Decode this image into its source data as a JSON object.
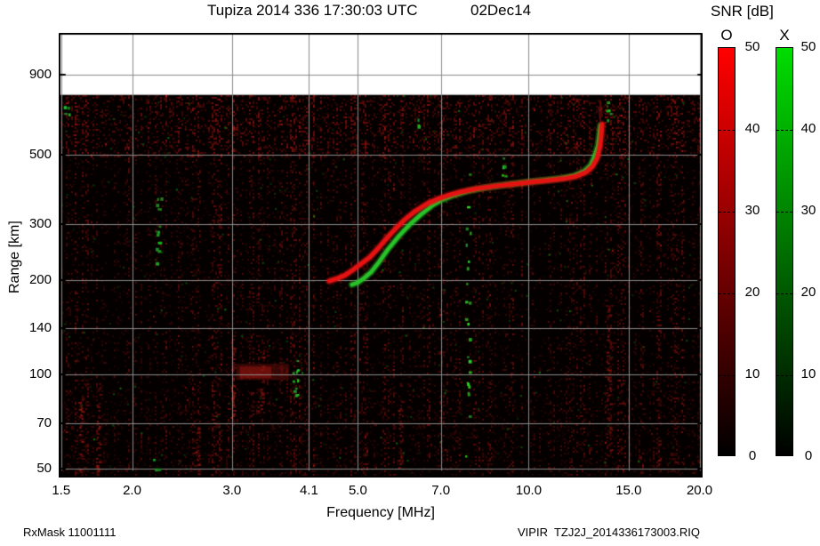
{
  "header": {
    "title": "Tupiza 2014 336 17:30:03 UTC",
    "date": "02Dec14"
  },
  "footer": {
    "rx_mask": "RxMask 11001111",
    "data_file": "VIPIR  TZJ2J_2014336173003.RIQ"
  },
  "chart_data": {
    "type": "heatmap",
    "title": "Tupiza 2014 336 17:30:03 UTC",
    "subtitle": "02Dec14",
    "x_axis": {
      "label": "Frequency [MHz]",
      "scale": "log",
      "lim": [
        1.485,
        20.25
      ],
      "tick_values": [
        1.5,
        2,
        3,
        4.1,
        5,
        7,
        10,
        15,
        20
      ],
      "tick_labels": [
        "1.5",
        "2.0",
        "3.0",
        "4.1",
        "5.0",
        "7.0",
        "10.0",
        "15.0",
        "20.0"
      ],
      "grid": true
    },
    "y_axis": {
      "label": "Range [km]",
      "scale": "log",
      "lim": [
        47,
        1220
      ],
      "tick_values": [
        50,
        70,
        100,
        140,
        200,
        300,
        500,
        900
      ],
      "tick_labels": [
        "50",
        "70",
        "100",
        "140",
        "200",
        "300",
        "500",
        "900"
      ],
      "grid": true
    },
    "data_region_top_km": 775,
    "colorbar": {
      "title": "SNR [dB]",
      "min": 0,
      "max": 50,
      "tick_values": [
        50,
        40,
        30,
        20,
        10,
        0
      ],
      "bars": [
        {
          "mode": "O",
          "top_color": "#ff0000"
        },
        {
          "mode": "X",
          "top_color": "#00dd00"
        }
      ]
    },
    "traces": [
      {
        "name": "O-mode echo",
        "color": "#e51212",
        "points": [
          [
            4.45,
            198
          ],
          [
            4.6,
            202
          ],
          [
            4.75,
            207
          ],
          [
            4.9,
            215
          ],
          [
            5.05,
            224
          ],
          [
            5.25,
            236
          ],
          [
            5.45,
            254
          ],
          [
            5.65,
            274
          ],
          [
            5.85,
            293
          ],
          [
            6.05,
            311
          ],
          [
            6.3,
            330
          ],
          [
            6.6,
            348
          ],
          [
            6.9,
            361
          ],
          [
            7.2,
            371
          ],
          [
            7.6,
            381
          ],
          [
            8.1,
            390
          ],
          [
            8.7,
            397
          ],
          [
            9.4,
            403
          ],
          [
            10.1,
            409
          ],
          [
            10.8,
            414
          ],
          [
            11.5,
            419
          ],
          [
            12.1,
            426
          ],
          [
            12.6,
            439
          ],
          [
            12.95,
            458
          ],
          [
            13.2,
            487
          ],
          [
            13.35,
            530
          ],
          [
            13.43,
            580
          ],
          [
            13.47,
            625
          ]
        ]
      },
      {
        "name": "X-mode echo",
        "color": "#28c228",
        "points": [
          [
            4.88,
            193
          ],
          [
            5.0,
            196
          ],
          [
            5.12,
            202
          ],
          [
            5.28,
            212
          ],
          [
            5.45,
            228
          ],
          [
            5.65,
            250
          ],
          [
            5.9,
            275
          ],
          [
            6.15,
            298
          ],
          [
            6.45,
            322
          ],
          [
            6.75,
            344
          ],
          [
            7.05,
            360
          ],
          [
            7.4,
            372
          ],
          [
            7.85,
            384
          ],
          [
            8.4,
            393
          ],
          [
            9.1,
            401
          ],
          [
            9.9,
            409
          ],
          [
            10.7,
            415
          ],
          [
            11.4,
            421
          ],
          [
            12.0,
            428
          ],
          [
            12.5,
            442
          ],
          [
            12.85,
            462
          ],
          [
            13.05,
            492
          ],
          [
            13.25,
            535
          ],
          [
            13.33,
            585
          ],
          [
            13.38,
            620
          ]
        ]
      }
    ],
    "features": {
      "red_patch": {
        "f_range": [
          3.05,
          3.78
        ],
        "r_range": [
          96,
          108
        ]
      },
      "green_columns": [
        {
          "f": 1.53,
          "r_range": [
            640,
            720
          ],
          "count": 4
        },
        {
          "f": 2.22,
          "r_range": [
            225,
            390
          ],
          "count": 16
        },
        {
          "f": 2.2,
          "r_range": [
            50,
            58
          ],
          "count": 3
        },
        {
          "f": 3.87,
          "r_range": [
            86,
            112
          ],
          "count": 10
        },
        {
          "f": 7.8,
          "r_range": [
            55,
            470
          ],
          "count": 24
        },
        {
          "f": 9.0,
          "r_range": [
            430,
            490
          ],
          "count": 6
        },
        {
          "f": 13.8,
          "r_range": [
            600,
            740
          ],
          "count": 5
        },
        {
          "f": 6.4,
          "r_range": [
            600,
            680
          ],
          "count": 3
        }
      ],
      "red_columns": [
        {
          "f": 1.62,
          "r_range": [
            48,
            85
          ]
        },
        {
          "f": 1.74,
          "r_range": [
            48,
            95
          ]
        },
        {
          "f": 2.6,
          "r_range": [
            48,
            70
          ]
        },
        {
          "f": 3.0,
          "r_range": [
            70,
            135
          ]
        },
        {
          "f": 3.38,
          "r_range": [
            75,
            120
          ]
        },
        {
          "f": 5.92,
          "r_range": [
            50,
            78
          ]
        },
        {
          "f": 13.8,
          "r_range": [
            55,
            170
          ]
        }
      ],
      "spread_wisps": [
        {
          "f": 13.38,
          "r_range": [
            640,
            712
          ]
        },
        {
          "f": 13.46,
          "r_range": [
            660,
            745
          ]
        }
      ]
    },
    "noise": {
      "seed": 987654321,
      "background": "#050000",
      "streak_density": 0.32,
      "green_dot_count": 300
    }
  }
}
